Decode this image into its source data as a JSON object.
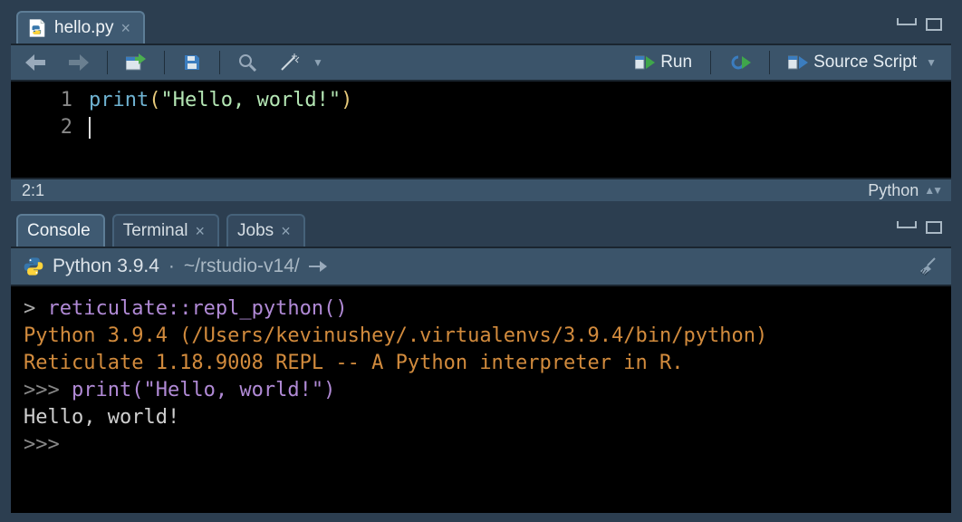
{
  "editor": {
    "tab": {
      "label": "hello.py"
    },
    "toolbar": {
      "run_label": "Run",
      "source_label": "Source Script"
    },
    "lines": [
      {
        "n": "1",
        "fn": "print",
        "open": "(",
        "str": "\"Hello, world!\"",
        "close": ")"
      },
      {
        "n": "2"
      }
    ],
    "status": {
      "pos": "2:1",
      "lang": "Python"
    }
  },
  "console": {
    "tabs": {
      "console": "Console",
      "terminal": "Terminal",
      "jobs": "Jobs"
    },
    "header": {
      "version": "Python 3.9.4",
      "path": "~/rstudio-v14/"
    },
    "lines": [
      {
        "p": "> ",
        "text": "reticulate::repl_python()",
        "cls": "c-call"
      },
      {
        "text": "Python 3.9.4 (/Users/kevinushey/.virtualenvs/3.9.4/bin/python)",
        "cls": "c-info"
      },
      {
        "text": "Reticulate 1.18.9008 REPL -- A Python interpreter in R.",
        "cls": "c-info"
      },
      {
        "p": ">>> ",
        "text": "print(\"Hello, world!\")",
        "cls": "c-input"
      },
      {
        "text": "Hello, world!",
        "cls": "c-out"
      },
      {
        "p": ">>> ",
        "text": "",
        "cls": "c-input"
      }
    ]
  }
}
